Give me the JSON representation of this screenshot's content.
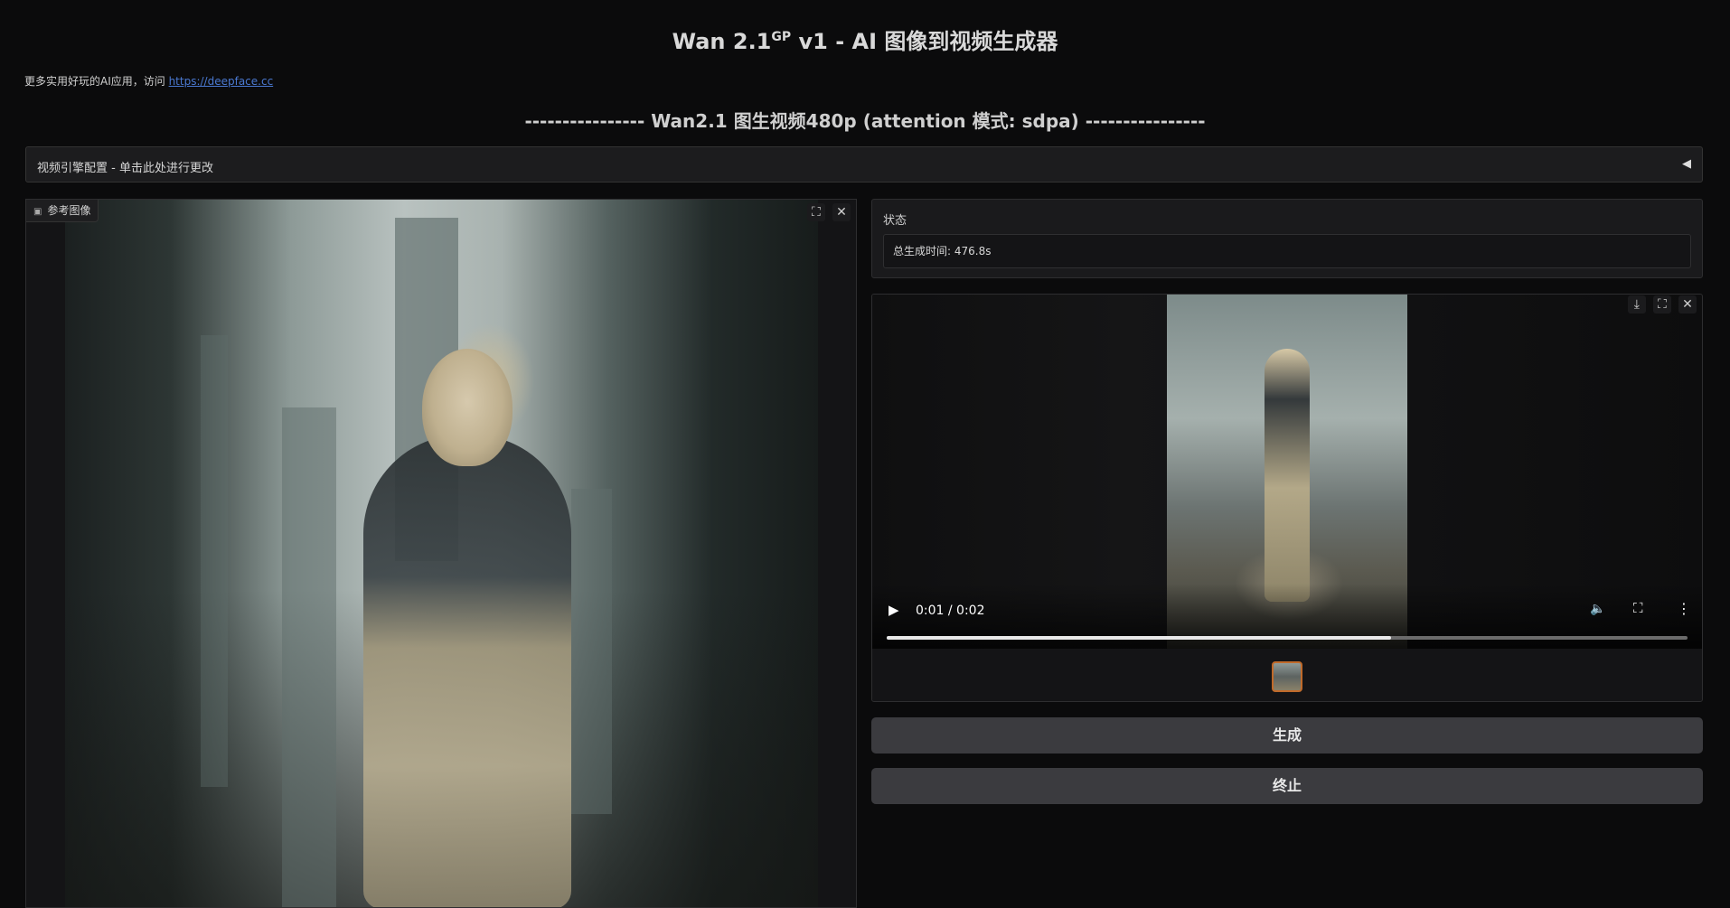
{
  "header": {
    "title_prefix": "Wan 2.1",
    "title_sup": "GP",
    "title_suffix": " v1 - AI 图像到视频生成器",
    "note_text": "更多实用好玩的AI应用，访问 ",
    "note_link": "https://deepface.cc",
    "section_heading": "---------------- Wan2.1 图生视频480p (attention 模式: sdpa) ----------------"
  },
  "accordion": {
    "label": "视频引擎配置 - 单击此处进行更改",
    "arrow": "◀"
  },
  "image_panel": {
    "label": "参考图像",
    "label_icon": "image-icon",
    "fullscreen_icon": "⛶",
    "close_icon": "✕"
  },
  "status": {
    "label": "状态",
    "value": "总生成时间: 476.8s"
  },
  "video": {
    "time": "0:01 / 0:02",
    "progress_fraction": 0.63,
    "download_icon": "⤓",
    "fullscreen_icon": "⛶",
    "close_icon": "✕"
  },
  "buttons": {
    "generate": "生成",
    "stop": "终止"
  }
}
